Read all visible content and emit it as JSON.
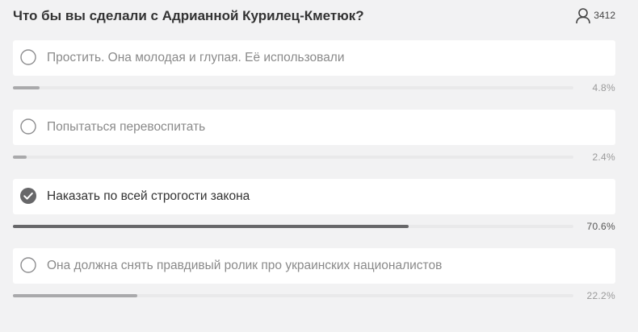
{
  "poll": {
    "title": "Что бы вы сделали с Адрианной Курилец-Кметюк?",
    "voters_count": "3412",
    "voters_icon": "person-icon",
    "colors": {
      "background": "#f2f2f3",
      "card": "#ffffff",
      "bar_selected": "#676769",
      "bar_other": "#a9a9ab",
      "track": "#e9e9ea"
    },
    "options": [
      {
        "label": "Простить. Она молодая и глупая. Её использовали",
        "percent": "4.8%",
        "fraction": 0.048,
        "selected": false
      },
      {
        "label": "Попытаться перевоспитать",
        "percent": "2.4%",
        "fraction": 0.024,
        "selected": false
      },
      {
        "label": "Наказать по всей строгости закона",
        "percent": "70.6%",
        "fraction": 0.706,
        "selected": true
      },
      {
        "label": "Она должна снять правдивый ролик про украинских националистов",
        "percent": "22.2%",
        "fraction": 0.222,
        "selected": false
      }
    ]
  }
}
